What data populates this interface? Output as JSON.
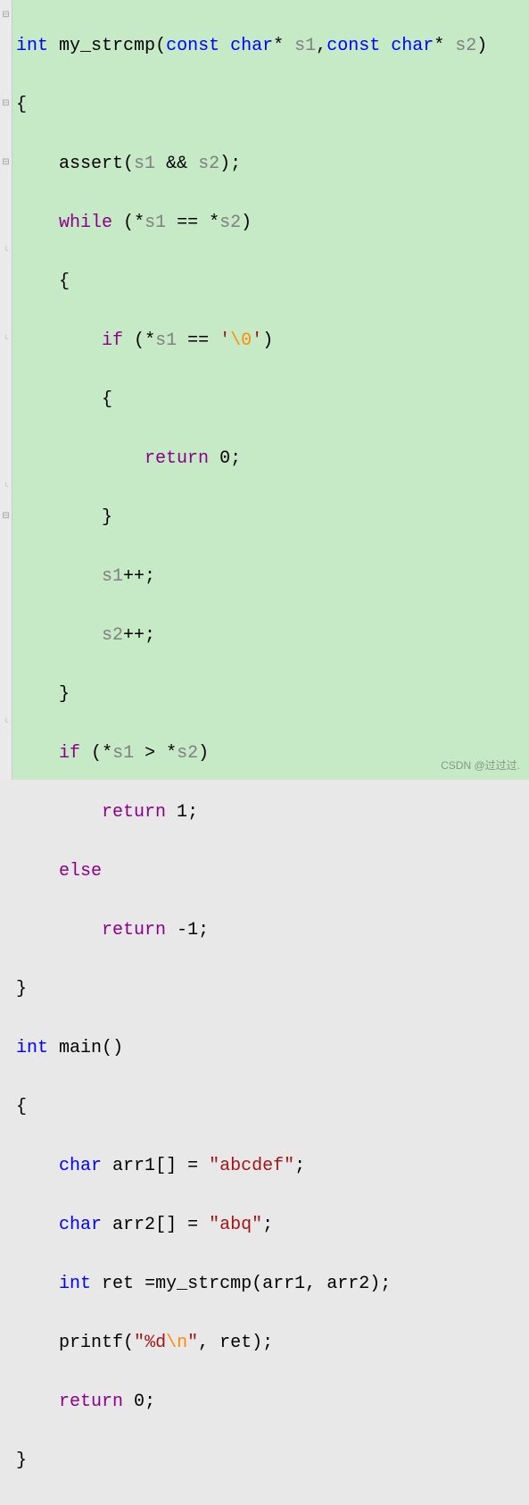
{
  "code": {
    "l1": {
      "int": "int",
      "fn": "my_strcmp",
      "lp": "(",
      "const1": "const",
      "char1": "char",
      "star1": "*",
      "p1": "s1",
      "comma": ",",
      "const2": "const",
      "char2": "char",
      "star2": "*",
      "p2": "s2",
      "rp": ")"
    },
    "l2": {
      "brace": "{"
    },
    "l3": {
      "assert": "assert",
      "lp": "(",
      "s1": "s1",
      "and": "&&",
      "s2": "s2",
      "rp": ")",
      "semi": ";"
    },
    "l4": {
      "while": "while",
      "lp": "(",
      "star1": "*",
      "s1": "s1",
      "eq": "==",
      "star2": "*",
      "s2": "s2",
      "rp": ")"
    },
    "l5": {
      "brace": "{"
    },
    "l6": {
      "if": "if",
      "lp": "(",
      "star": "*",
      "s1": "s1",
      "eq": "==",
      "q1": "'",
      "esc": "\\0",
      "q2": "'",
      "rp": ")"
    },
    "l7": {
      "brace": "{"
    },
    "l8": {
      "return": "return",
      "val": "0",
      "semi": ";"
    },
    "l9": {
      "brace": "}"
    },
    "l10": {
      "s1": "s1",
      "inc": "++",
      "semi": ";"
    },
    "l11": {
      "s2": "s2",
      "inc": "++",
      "semi": ";"
    },
    "l12": {
      "brace": "}"
    },
    "l13": {
      "if": "if",
      "lp": "(",
      "star1": "*",
      "s1": "s1",
      "gt": ">",
      "star2": "*",
      "s2": "s2",
      "rp": ")"
    },
    "l14": {
      "return": "return",
      "val": "1",
      "semi": ";"
    },
    "l15": {
      "else": "else"
    },
    "l16": {
      "return": "return",
      "neg": "-",
      "val": "1",
      "semi": ";"
    },
    "l17": {
      "brace": "}"
    },
    "l18": {
      "int": "int",
      "fn": "main",
      "lp": "(",
      "rp": ")"
    },
    "l19": {
      "brace": "{"
    },
    "l20": {
      "char": "char",
      "var": "arr1",
      "brk": "[]",
      "eq": "=",
      "q1": "\"",
      "str": "abcdef",
      "q2": "\"",
      "semi": ";"
    },
    "l21": {
      "char": "char",
      "var": "arr2",
      "brk": "[]",
      "eq": "=",
      "q1": "\"",
      "str": "abq",
      "q2": "\"",
      "semi": ";"
    },
    "l22": {
      "int": "int",
      "var": "ret",
      "eq": "=",
      "fn": "my_strcmp",
      "lp": "(",
      "a1": "arr1",
      "comma": ",",
      "a2": "arr2",
      "rp": ")",
      "semi": ";"
    },
    "l23": {
      "fn": "printf",
      "lp": "(",
      "q1": "\"",
      "fmt": "%d",
      "esc": "\\n",
      "q2": "\"",
      "comma": ",",
      "arg": "ret",
      "rp": ")",
      "semi": ";"
    },
    "l24": {
      "return": "return",
      "val": "0",
      "semi": ";"
    },
    "l25": {
      "brace": "}"
    }
  },
  "watermark": "CSDN @过过过."
}
